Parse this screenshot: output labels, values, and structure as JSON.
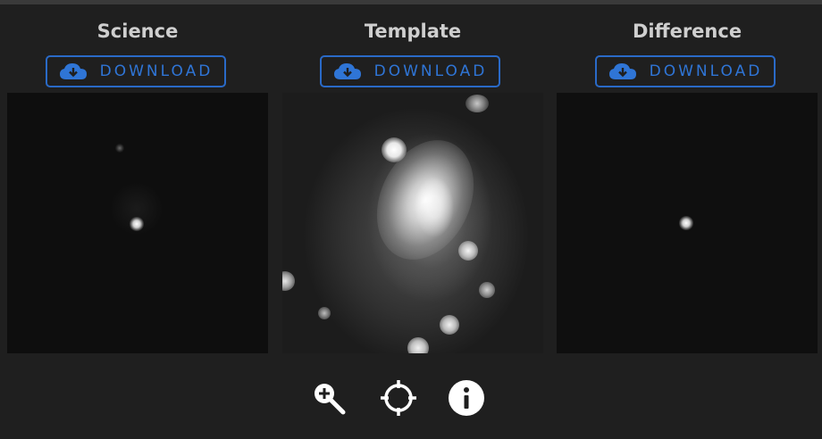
{
  "panels": [
    {
      "title": "Science",
      "download_label": "DOWNLOAD"
    },
    {
      "title": "Template",
      "download_label": "DOWNLOAD"
    },
    {
      "title": "Difference",
      "download_label": "DOWNLOAD"
    }
  ],
  "colors": {
    "accent": "#2f75d6",
    "background": "#1f1f1f",
    "title_text": "#cfcfcf"
  },
  "icons": {
    "download": "cloud-download-icon",
    "zoom": "zoom-in-icon",
    "target": "crosshair-icon",
    "info": "info-icon"
  }
}
